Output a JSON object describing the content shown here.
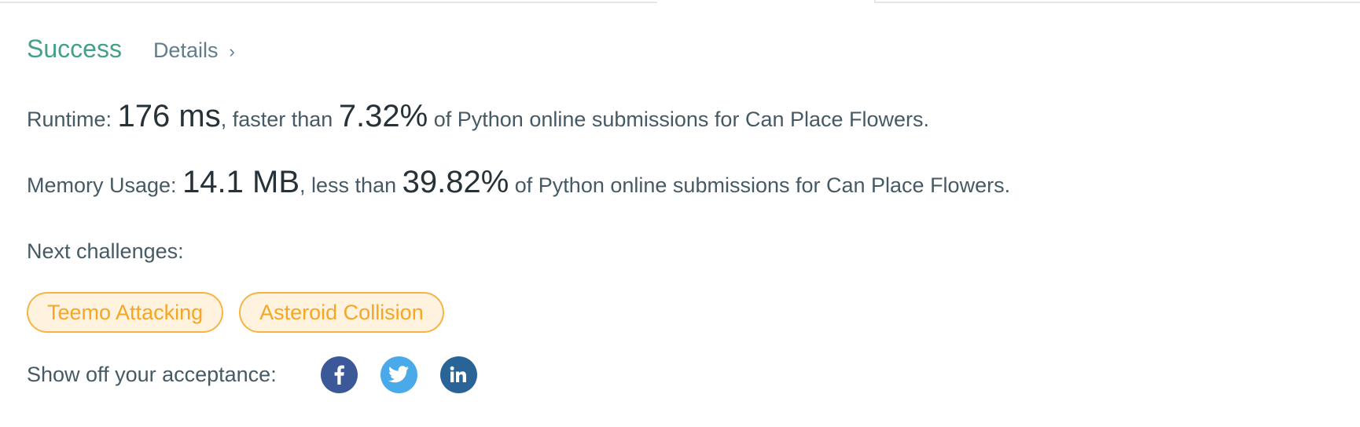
{
  "status": {
    "title": "Success",
    "details_label": "Details",
    "details_chevron": "›"
  },
  "runtime": {
    "label": "Runtime: ",
    "value": "176 ms",
    "middle": ", faster than ",
    "percent": "7.32%",
    "suffix": " of Python online submissions for Can Place Flowers."
  },
  "memory": {
    "label": "Memory Usage: ",
    "value": "14.1 MB",
    "middle": ", less than ",
    "percent": "39.82%",
    "suffix": " of Python online submissions for Can Place Flowers."
  },
  "next": {
    "label": "Next challenges:",
    "items": [
      "Teemo Attacking",
      "Asteroid Collision"
    ]
  },
  "share": {
    "label": "Show off your acceptance:",
    "icons": [
      "facebook-icon",
      "twitter-icon",
      "linkedin-icon"
    ]
  },
  "colors": {
    "success": "#43a08a",
    "chip_border": "#f5b443",
    "chip_text": "#f5a623",
    "chip_bg": "#fff3e0",
    "facebook": "#3b5998",
    "twitter": "#4aa9e8",
    "linkedin": "#2a6496"
  }
}
